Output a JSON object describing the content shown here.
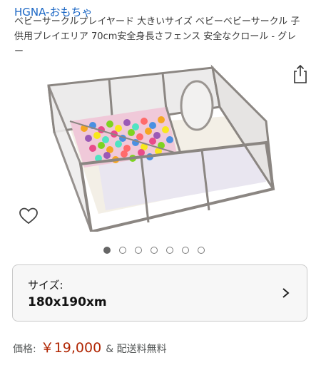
{
  "product": {
    "brand": "HGNA-おもちゃ",
    "title": "ベビーサークルプレイヤード 大きいサイズ ベビーベビーサークル 子供用プレイエリア 70cm安全身長さフェンス 安全なクロール - グレー"
  },
  "gallery": {
    "image_count": 7,
    "active_index": 0
  },
  "icons": {
    "share": "share-icon",
    "wishlist": "heart-icon",
    "chevron": "chevron-right-icon"
  },
  "size_selector": {
    "label": "サイズ:",
    "value": "180x190xm"
  },
  "price": {
    "label": "価格:",
    "value": "￥19,000",
    "shipping": "& 配送料無料"
  },
  "colors": {
    "brand_link": "#1a66c4",
    "price": "#b12704",
    "card_bg": "#f7f7f7",
    "card_border": "#c9c9c9"
  }
}
